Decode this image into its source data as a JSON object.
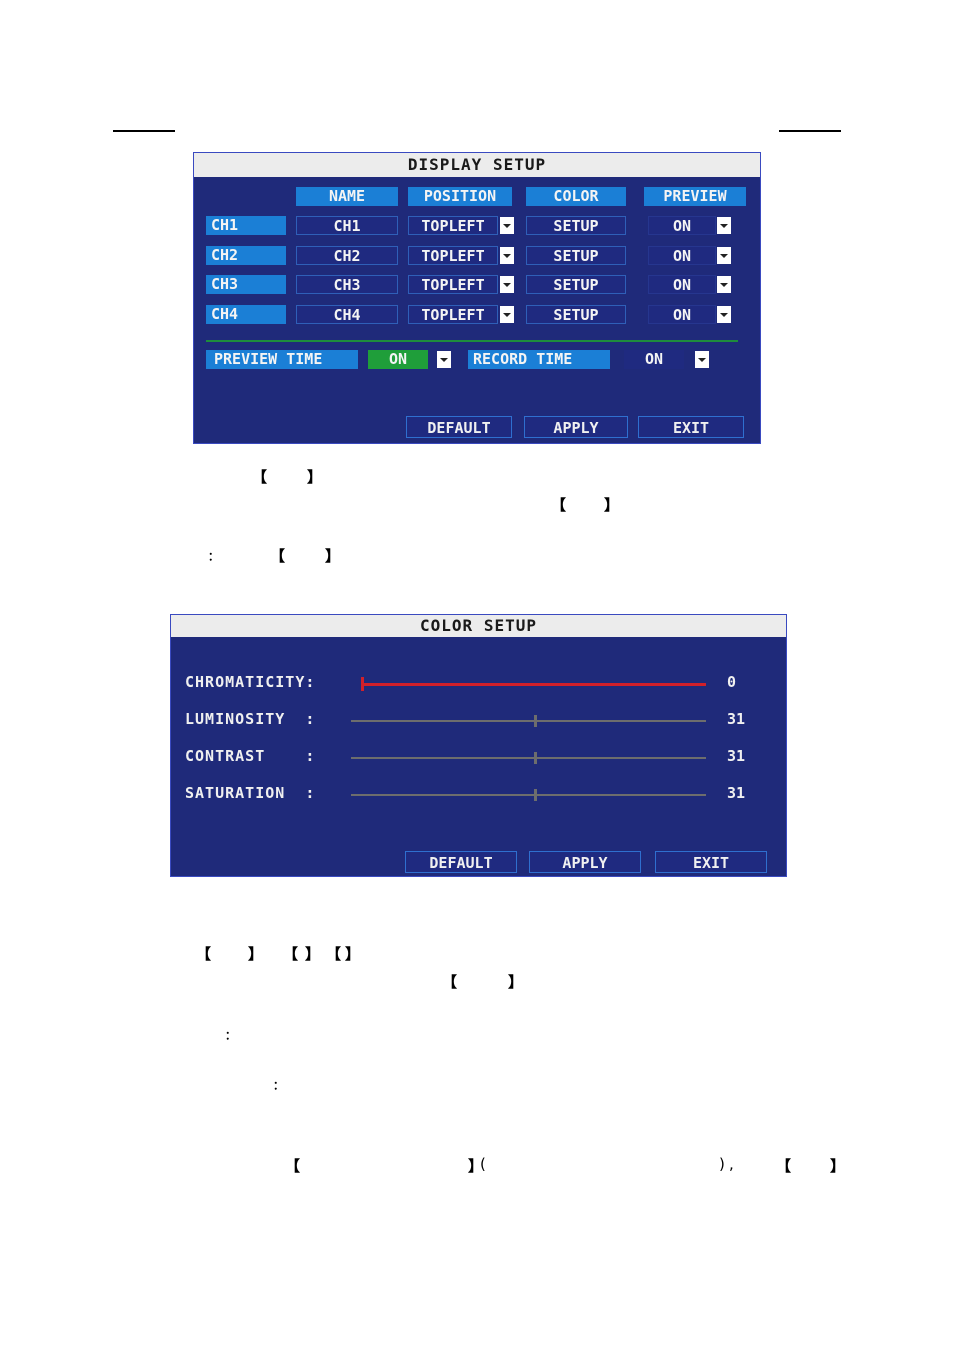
{
  "display_setup": {
    "title": "DISPLAY SETUP",
    "headers": [
      "NAME",
      "POSITION",
      "COLOR",
      "PREVIEW"
    ],
    "rows": [
      {
        "channel": "CH1",
        "name": "CH1",
        "position": "TOPLEFT",
        "color": "SETUP",
        "preview": "ON"
      },
      {
        "channel": "CH2",
        "name": "CH2",
        "position": "TOPLEFT",
        "color": "SETUP",
        "preview": "ON"
      },
      {
        "channel": "CH3",
        "name": "CH3",
        "position": "TOPLEFT",
        "color": "SETUP",
        "preview": "ON"
      },
      {
        "channel": "CH4",
        "name": "CH4",
        "position": "TOPLEFT",
        "color": "SETUP",
        "preview": "ON"
      }
    ],
    "preview_time_label": "PREVIEW TIME",
    "preview_time_value": "ON",
    "record_time_label": "RECORD TIME",
    "record_time_value": "ON",
    "buttons": {
      "default": "DEFAULT",
      "apply": "APPLY",
      "exit": "EXIT"
    }
  },
  "color_setup": {
    "title": "COLOR SETUP",
    "sliders": [
      {
        "label": "CHROMATICITY:",
        "value": "0",
        "fraction": 0.0,
        "active": true
      },
      {
        "label": "LUMINOSITY  :",
        "value": "31",
        "fraction": 0.5,
        "active": false
      },
      {
        "label": "CONTRAST    :",
        "value": "31",
        "fraction": 0.5,
        "active": false
      },
      {
        "label": "SATURATION  :",
        "value": "31",
        "fraction": 0.5,
        "active": false
      }
    ],
    "buttons": {
      "default": "DEFAULT",
      "apply": "APPLY",
      "exit": "EXIT"
    }
  },
  "text_fragments": {
    "lb": "【",
    "rb": "】",
    "colon": "：",
    "lp": "(",
    "rp": ")",
    "comma": ","
  },
  "colors": {
    "panel_bg": "#1f2a7a",
    "header_blue": "#1b7fd6",
    "green_active": "#1f9e3a",
    "slider_red": "#d1202a"
  }
}
